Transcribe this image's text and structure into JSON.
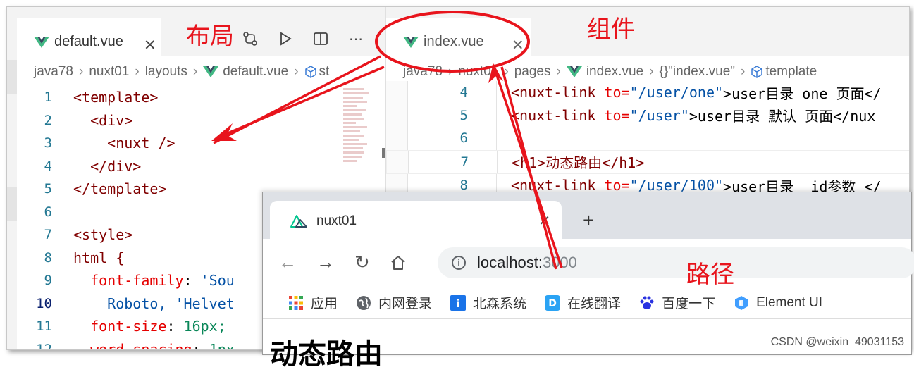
{
  "left_editor": {
    "tab": {
      "label": "default.vue",
      "close": "✕"
    },
    "breadcrumb": [
      "java78",
      "nuxt01",
      "layouts",
      "default.vue",
      "st"
    ],
    "lines": [
      {
        "n": "1",
        "text": "<template>"
      },
      {
        "n": "2",
        "text": "  <div>"
      },
      {
        "n": "3",
        "text": "    <nuxt />"
      },
      {
        "n": "4",
        "text": "  </div>"
      },
      {
        "n": "5",
        "text": "</template>"
      },
      {
        "n": "6",
        "text": ""
      },
      {
        "n": "7",
        "text": "<style>"
      },
      {
        "n": "8",
        "text": "html {"
      },
      {
        "n": "9",
        "prop": "font-family",
        "value": "'Sou"
      },
      {
        "n": "10",
        "text": "    Roboto, 'Helvet"
      },
      {
        "n": "11",
        "prop": "font-size",
        "value": "16px;"
      },
      {
        "n": "12",
        "prop": "word-spacing",
        "value": "1px"
      }
    ]
  },
  "right_editor": {
    "tab": {
      "label": "index.vue",
      "close": "✕"
    },
    "breadcrumb": [
      "java78",
      "nuxt01",
      "pages",
      "index.vue",
      "{}\"index.vue\"",
      "template"
    ],
    "lines": [
      {
        "n": "4",
        "pre": "<nuxt-link ",
        "attr": "to=",
        "str": "\"/user/one\"",
        "post": ">user目录 one 页面</"
      },
      {
        "n": "5",
        "pre": "<nuxt-link ",
        "attr": "to=",
        "str": "\"/user\"",
        "post": ">user目录 默认 页面</nux"
      },
      {
        "n": "6",
        "pre": "",
        "attr": "",
        "str": "",
        "post": ""
      },
      {
        "n": "7",
        "pre": "<h1>动态路由</h1>",
        "attr": "",
        "str": "",
        "post": ""
      },
      {
        "n": "8",
        "pre": "<nuxt-link ",
        "attr": "to=",
        "str": "\"/user/100\"",
        "post": ">user目录  id参数 </"
      }
    ]
  },
  "browser": {
    "tab_title": "nuxt01",
    "url_host": "localhost:",
    "url_port": "3000",
    "bookmarks": [
      "应用",
      "内网登录",
      "北森系统",
      "在线翻译",
      "百度一下",
      "Element UI"
    ],
    "page_heading": "动态路由"
  },
  "annotations": {
    "layout": "布局",
    "component": "组件",
    "route": "路径"
  },
  "watermark": "CSDN @weixin_49031153",
  "colors": {
    "annotation_red": "#e8141c",
    "vue_green": "#41b883"
  }
}
